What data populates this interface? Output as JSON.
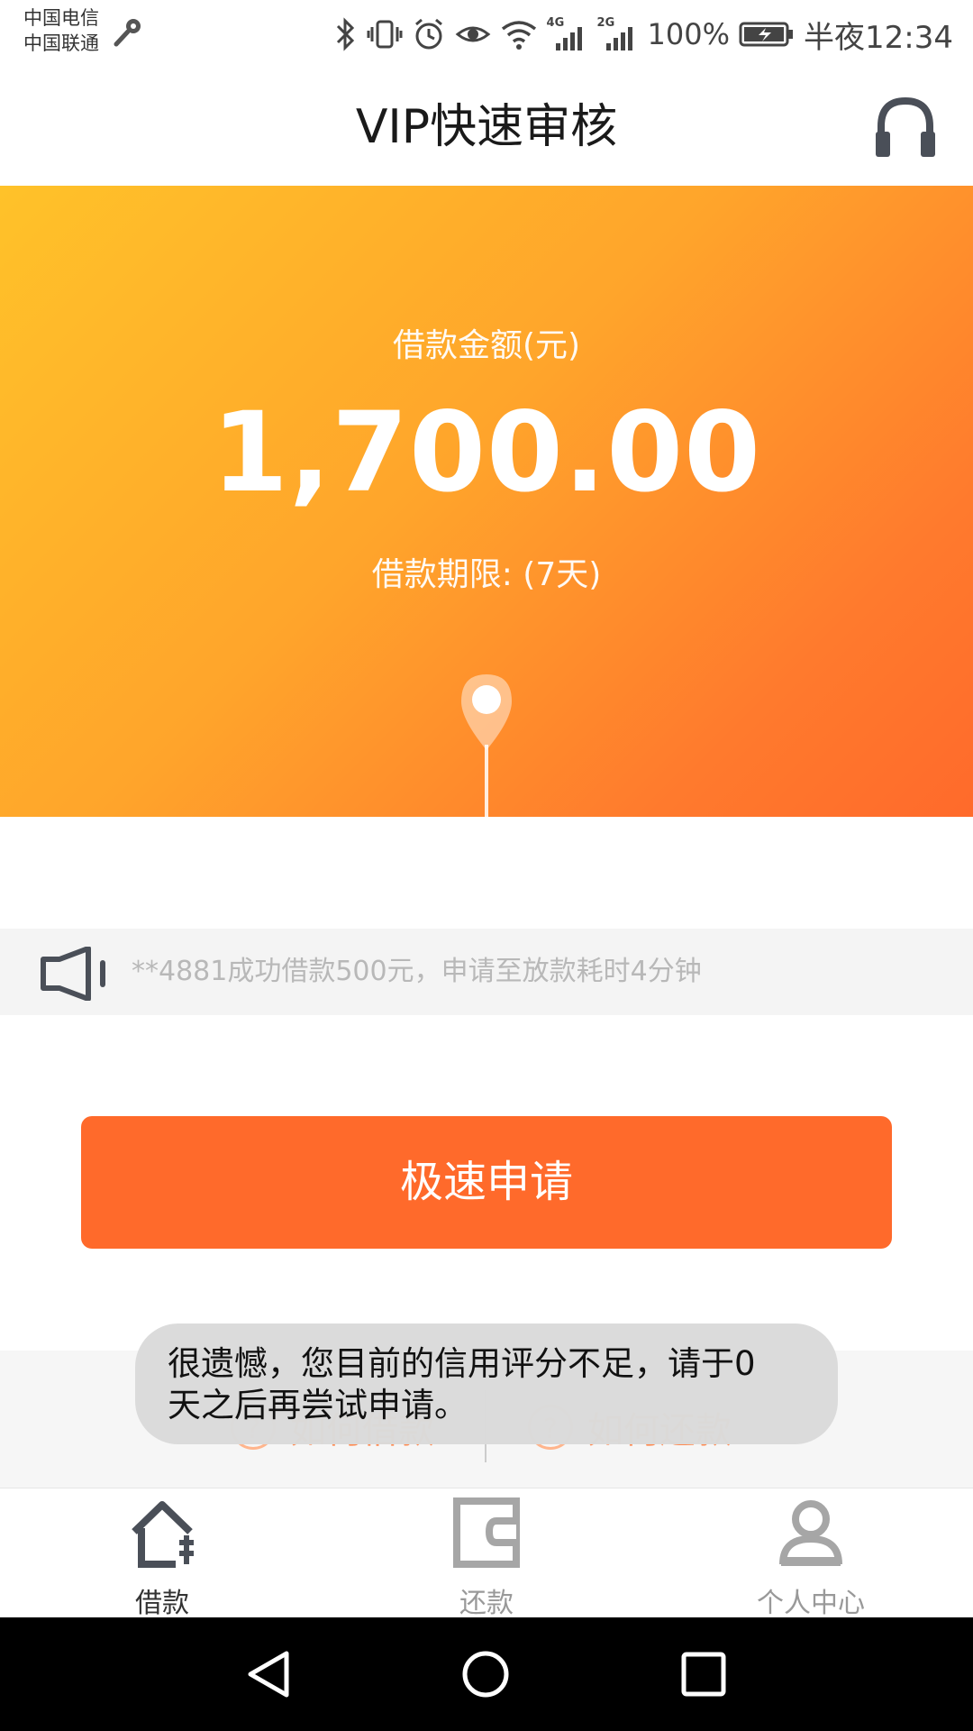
{
  "status_bar": {
    "carrier1": "中国电信",
    "carrier2": "中国联通",
    "net_4g": "4G",
    "net_2g": "2G",
    "battery": "100%",
    "time": "半夜12:34"
  },
  "header": {
    "title": "VIP快速审核",
    "service_icon": "headset-icon"
  },
  "loan": {
    "amount_label": "借款金额(元)",
    "amount": "1,700.00",
    "term_label": "借款期限: (7天)",
    "slider_value": 1700,
    "ruler_labels": [
      "0",
      "1000",
      "2000",
      "3000"
    ]
  },
  "notice": {
    "icon": "speaker-icon",
    "text": "**4881成功借款500元，申请至放款耗时4分钟"
  },
  "apply_button": "极速申请",
  "help": {
    "how_borrow": "如何借款",
    "how_repay": "如何还款",
    "q": "?"
  },
  "toast": {
    "line1": "很遗憾，您目前的信用评分不足，请于0",
    "line2": "天之后再尝试申请。"
  },
  "tabs": [
    {
      "label": "借款",
      "icon": "home-icon",
      "active": true
    },
    {
      "label": "还款",
      "icon": "wallet-icon",
      "active": false
    },
    {
      "label": "个人中心",
      "icon": "person-icon",
      "active": false
    }
  ],
  "colors": {
    "accent": "#ff6a2b",
    "hero_start": "#ffc229",
    "hero_end": "#ff6a2b",
    "tab_active": "#333333",
    "tab_inactive": "#999999"
  }
}
